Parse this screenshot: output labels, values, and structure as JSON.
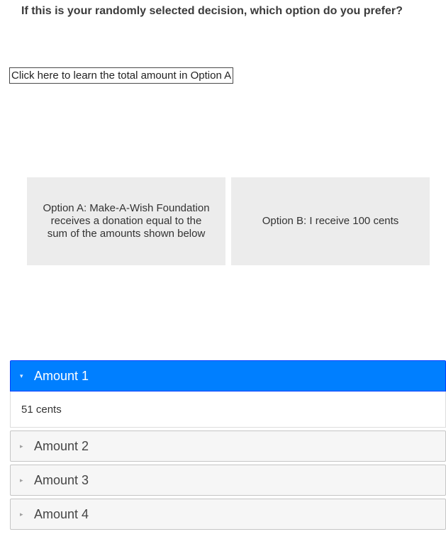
{
  "question": "If this is your randomly selected decision, which option do you prefer?",
  "reveal_button_label": "Click here to learn the total amount in Option A",
  "options": {
    "a_label": "Option A: Make-A-Wish Foundation receives a donation equal to the sum of the amounts shown below",
    "b_label": "Option B: I receive 100 cents"
  },
  "accordion": {
    "expanded_index": 0,
    "items": [
      {
        "title": "Amount 1",
        "content": "51 cents"
      },
      {
        "title": "Amount 2"
      },
      {
        "title": "Amount 3"
      },
      {
        "title": "Amount 4"
      }
    ]
  },
  "icons": {
    "expanded": "triangle-down-icon",
    "collapsed": "triangle-right-icon"
  },
  "colors": {
    "active_header": "#007fff",
    "option_background": "#ececec"
  }
}
